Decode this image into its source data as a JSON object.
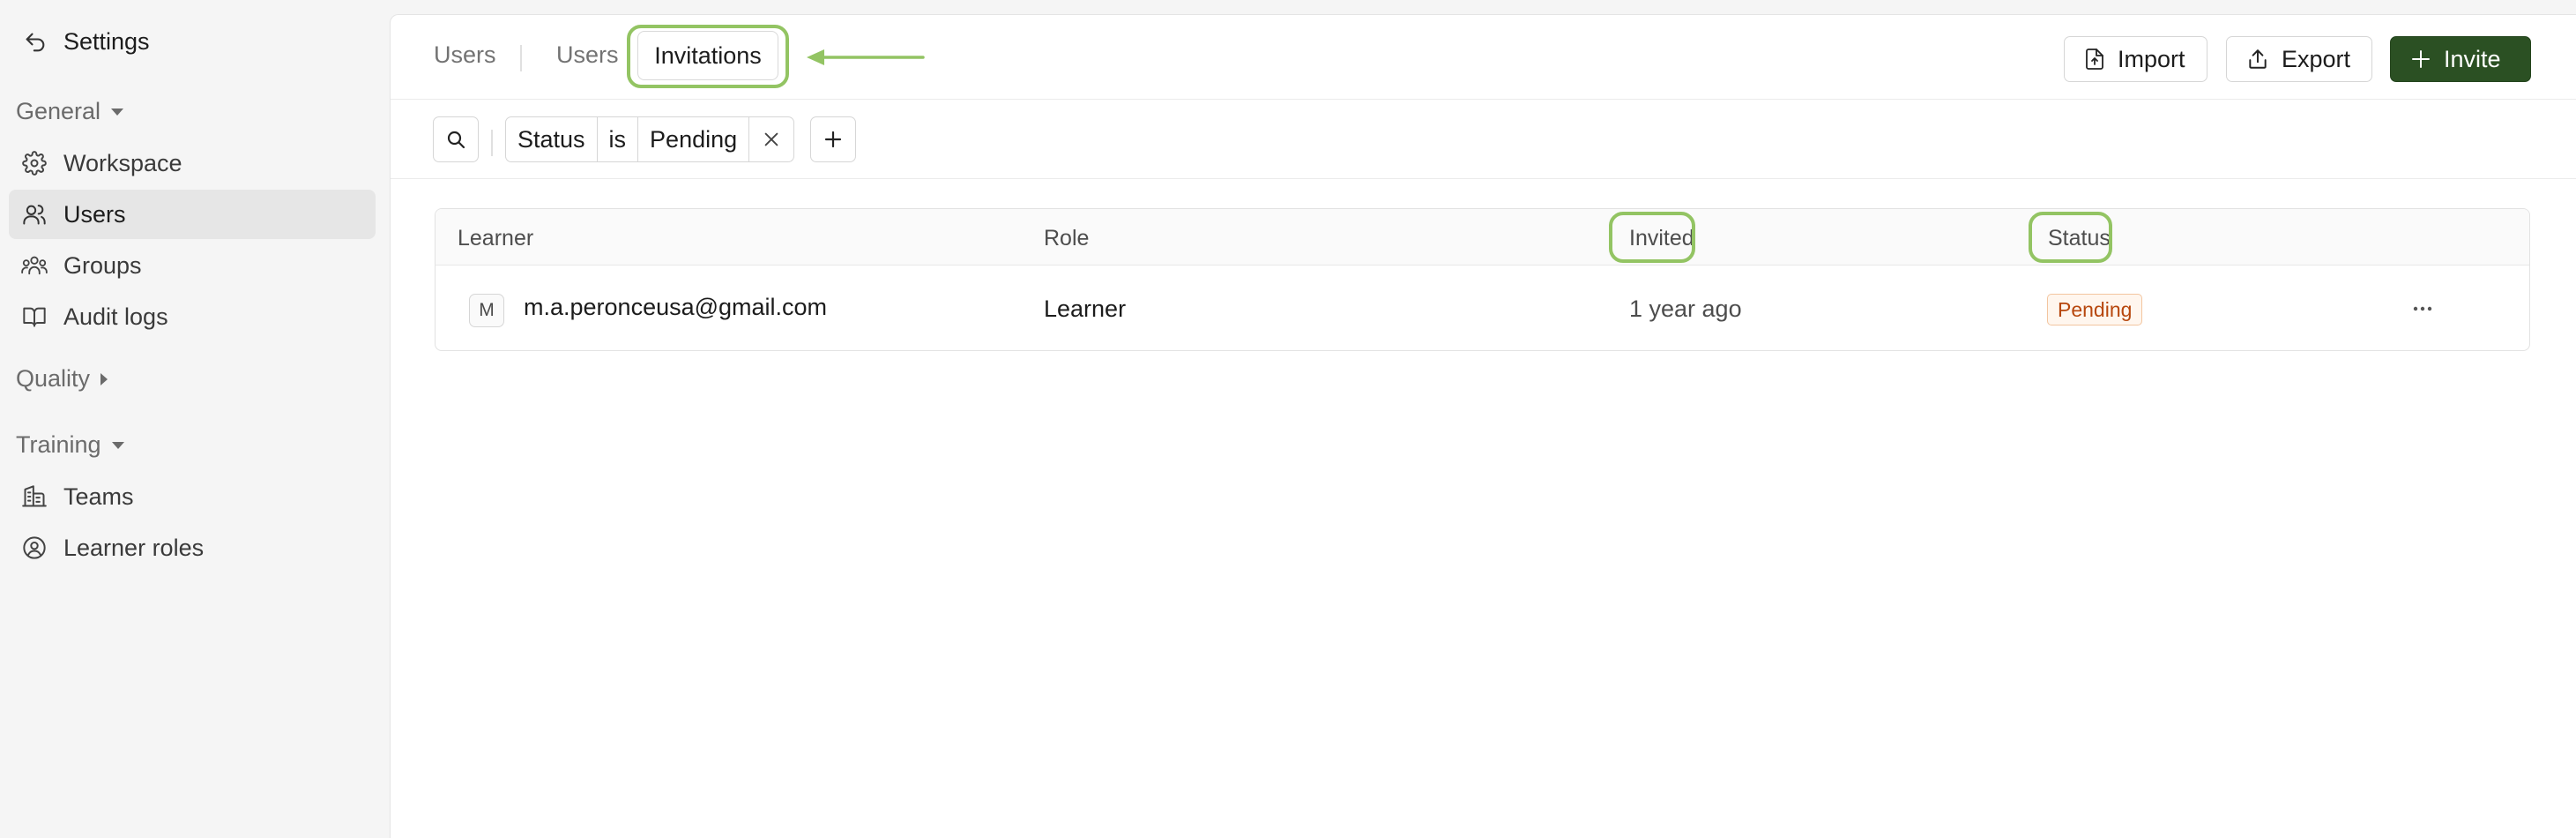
{
  "sidebar": {
    "title": "Settings",
    "sections": {
      "general": "General",
      "quality": "Quality",
      "training": "Training"
    },
    "items": {
      "workspace": "Workspace",
      "users": "Users",
      "groups": "Groups",
      "audit_logs": "Audit logs",
      "teams": "Teams",
      "learner_roles": "Learner roles"
    },
    "active_item": "Users"
  },
  "header": {
    "tabs": [
      "Users",
      "Users",
      "Invitations"
    ],
    "active_tab": "Invitations",
    "import_label": "Import",
    "export_label": "Export",
    "invite_label": "Invite"
  },
  "filter": {
    "field": "Status",
    "operator": "is",
    "value": "Pending"
  },
  "table": {
    "columns": [
      "Learner",
      "Role",
      "Invited",
      "Status"
    ],
    "rows": [
      {
        "avatar_initial": "M",
        "email": "m.a.peronceusa@gmail.com",
        "role": "Learner",
        "invited": "1 year ago",
        "status": "Pending"
      }
    ]
  },
  "colors": {
    "primary_button": "#2b5023",
    "highlight_outline": "#93c463",
    "status_pending_text": "#b7470d",
    "status_pending_bg": "#fff6ee"
  },
  "icons": {
    "back": "undo-arrow-icon",
    "workspace": "gear-icon",
    "users": "users-icon",
    "groups": "groups-icon",
    "audit_logs": "book-icon",
    "teams": "building-icon",
    "learner_roles": "user-circle-icon",
    "import": "file-import-icon",
    "export": "share-export-icon",
    "invite": "plus-icon",
    "search": "search-icon",
    "remove_filter": "close-icon",
    "add_filter": "plus-icon",
    "row_actions": "ellipsis-icon"
  }
}
